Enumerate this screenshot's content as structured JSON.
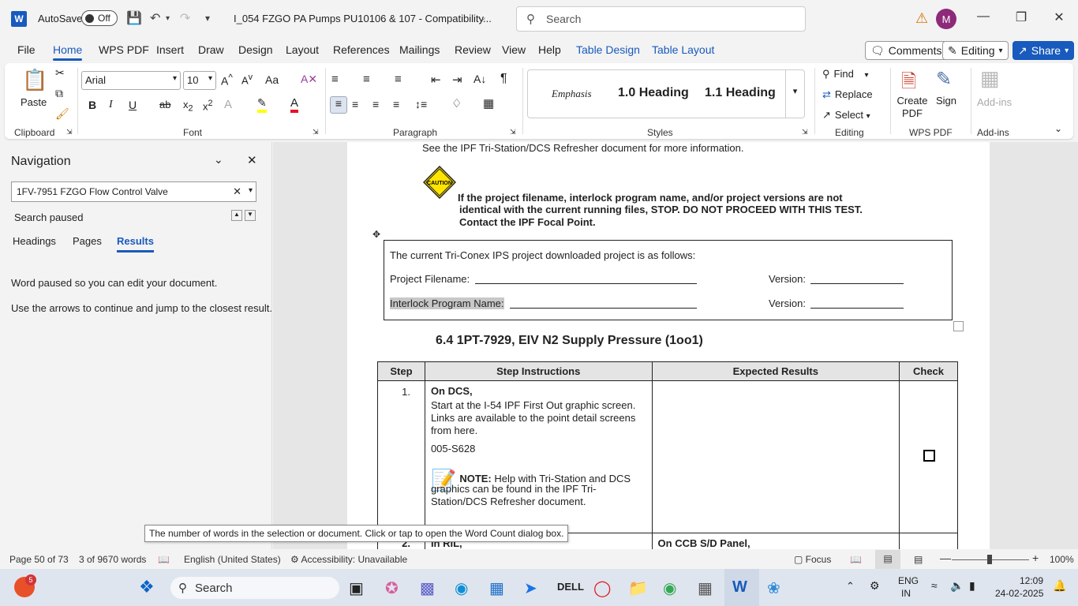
{
  "titlebar": {
    "autosave_label": "AutoSave",
    "autosave_state": "Off",
    "doc_title": "I_054 FZGO PA Pumps PU10106 & 107  -  Compatibility...",
    "search_placeholder": "Search",
    "avatar_initial": "M"
  },
  "tabs": [
    "File",
    "Home",
    "WPS PDF",
    "Insert",
    "Draw",
    "Design",
    "Layout",
    "References",
    "Mailings",
    "Review",
    "View",
    "Help",
    "Table Design",
    "Table Layout"
  ],
  "top_buttons": {
    "comments": "Comments",
    "editing": "Editing",
    "share": "Share"
  },
  "ribbon": {
    "clipboard": {
      "paste": "Paste",
      "label": "Clipboard"
    },
    "font": {
      "name": "Arial",
      "size": "10",
      "label": "Font",
      "case": "Aa"
    },
    "paragraph": {
      "label": "Paragraph"
    },
    "styles": {
      "items": [
        "Emphasis",
        "1.0  Heading",
        "1.1  Heading"
      ],
      "label": "Styles"
    },
    "editing": {
      "find": "Find",
      "replace": "Replace",
      "select": "Select",
      "label": "Editing"
    },
    "wps": {
      "create_pdf": "Create PDF",
      "sign": "Sign",
      "label": "WPS PDF"
    },
    "addins": {
      "addins": "Add-ins",
      "label": "Add-ins"
    }
  },
  "nav": {
    "title": "Navigation",
    "search_value": "1FV-7951 FZGO Flow Control Valve",
    "status": "Search paused",
    "tabs": [
      "Headings",
      "Pages",
      "Results"
    ],
    "msg1": "Word paused so you can edit your document.",
    "msg2": "Use the arrows to continue and jump to the closest result."
  },
  "doc": {
    "see_line": "See the IPF Tri-Station/DCS Refresher document for more information.",
    "caution_label": "CAUTION",
    "warning_lines": [
      "If the project filename, interlock program name, and/or project versions are not",
      "identical with the current running files, STOP. DO NOT PROCEED WITH THIS TEST.",
      "Contact the IPF Focal Point."
    ],
    "box_line1": "The current Tri-Conex IPS project downloaded project is as follows:",
    "project_filename_label": "Project Filename:",
    "interlock_label": "Interlock Program Name",
    "interlock_colon": ":",
    "version_label": "Version:",
    "section_heading": "6.4  1PT-7929, EIV N2 Supply Pressure (1oo1)",
    "table": {
      "headers": [
        "Step",
        "Step Instructions",
        "Expected Results",
        "Check"
      ],
      "row1": {
        "step": "1.",
        "title": "On DCS,",
        "lines": [
          "Start at the I-54 IPF First Out graphic screen.",
          "Links are available to the point detail screens",
          "from here."
        ],
        "code": "005-S628",
        "note_label": "NOTE:",
        "note_text": " Help with Tri-Station and DCS",
        "note_lines": [
          "graphics can be found in the IPF Tri-",
          "Station/DCS Refresher document."
        ]
      },
      "row2": {
        "step": "2.",
        "instr": "In RIL,",
        "expected": "On CCB S/D Panel,"
      }
    },
    "tooltip": "The number of words in the selection or document. Click or tap to open the Word Count dialog box."
  },
  "statusbar": {
    "page": "Page 50 of 73",
    "words": "3 of 9670 words",
    "language": "English (United States)",
    "accessibility": "Accessibility: Unavailable",
    "focus": "Focus",
    "zoom": "100%"
  },
  "taskbar": {
    "search": "Search",
    "badge": "5",
    "lang_top": "ENG",
    "lang_bottom": "IN",
    "time": "12:09",
    "date": "24-02-2025"
  }
}
